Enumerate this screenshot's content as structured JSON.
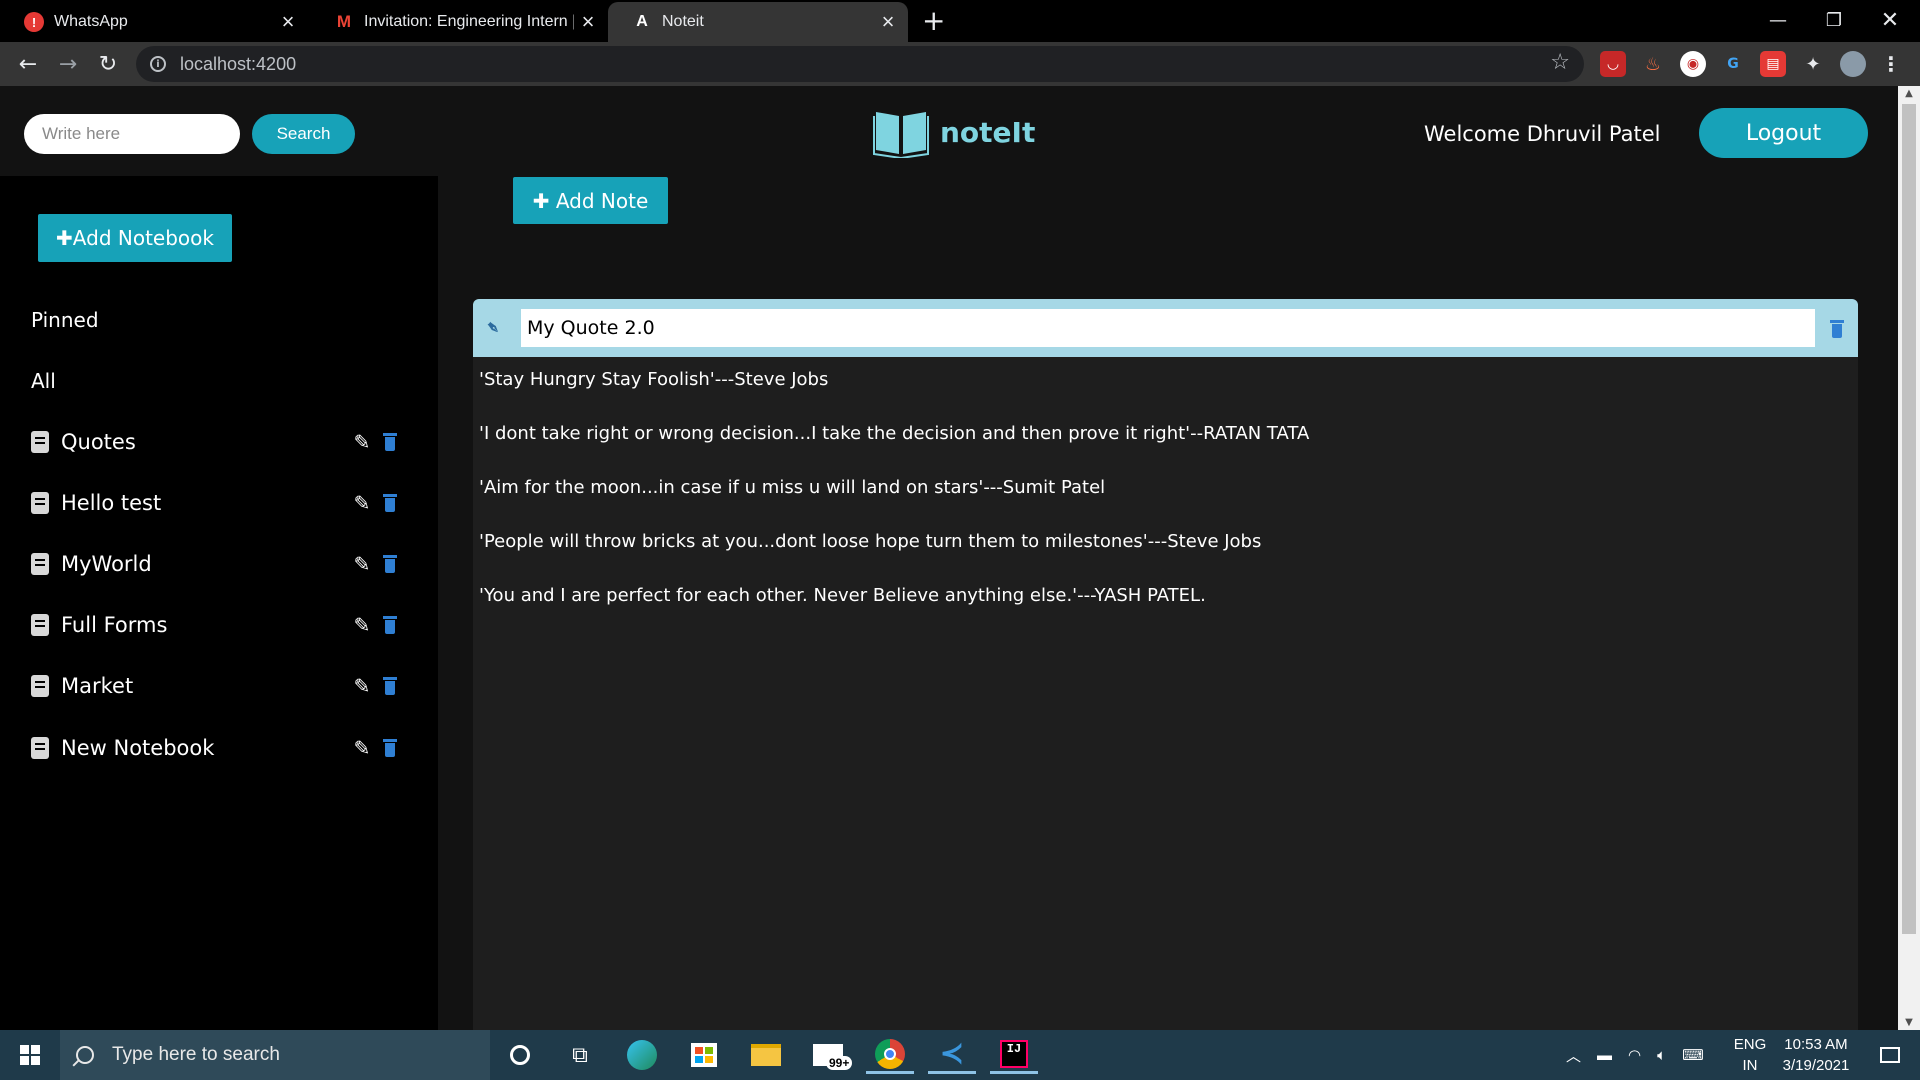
{
  "browser": {
    "tabs": [
      {
        "title": "WhatsApp",
        "favicon_color": "#e53935",
        "favicon_glyph": "!"
      },
      {
        "title": "Invitation: Engineering Intern | Te",
        "favicon_color": "#ffffff",
        "favicon_glyph": "M"
      },
      {
        "title": "Noteit",
        "favicon_color": "#353535",
        "favicon_glyph": "A"
      }
    ],
    "url": "localhost:4200"
  },
  "header": {
    "search_placeholder": "Write here",
    "search_button": "Search",
    "brand": "noteIt",
    "welcome": "Welcome Dhruvil Patel",
    "logout": "Logout"
  },
  "sidebar": {
    "add_notebook": "Add Notebook",
    "pinned": "Pinned",
    "all": "All",
    "notebooks": [
      {
        "label": "Quotes"
      },
      {
        "label": "Hello test"
      },
      {
        "label": "MyWorld"
      },
      {
        "label": "Full Forms"
      },
      {
        "label": "Market"
      },
      {
        "label": "New Notebook"
      }
    ]
  },
  "main": {
    "add_note": "Add Note",
    "note": {
      "title": "My Quote 2.0",
      "lines": [
        "'Stay Hungry Stay Foolish'---Steve Jobs",
        "'I dont take right or wrong decision...I take the decision and then prove it right'--RATAN TATA",
        "'Aim for the moon...in case if u miss u will land on stars'---Sumit Patel",
        "'People will throw bricks at you...dont loose hope turn them to milestones'---Steve Jobs",
        "'You and I are perfect for each other. Never Believe anything else.'---YASH PATEL."
      ]
    }
  },
  "taskbar": {
    "search_placeholder": "Type here to search",
    "mail_badge": "99+",
    "lang_top": "ENG",
    "lang_bottom": "IN",
    "time": "10:53 AM",
    "date": "3/19/2021"
  },
  "colors": {
    "accent": "#17a2b8",
    "note_header": "#a6d8e6",
    "trash_blue": "#2f7fd3",
    "brand": "#7fd4e0"
  }
}
